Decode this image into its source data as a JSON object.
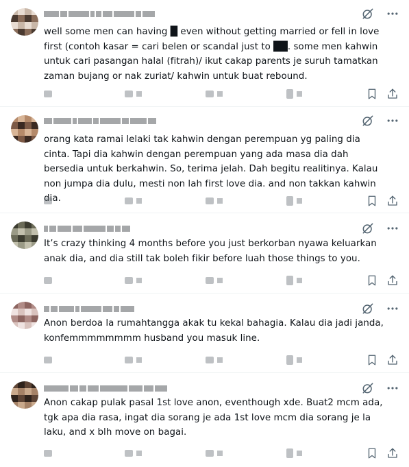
{
  "posts": [
    {
      "text": "well some men can having █ even without getting married or fell in love first (contoh kasar = cari belen or scandal just to ██. some men kahwin untuk cari pasangan halal (fitrah)/ ikut cakap parents je suruh tamatkan zaman bujang or nak zuriat/ kahwin untuk buat rebound.",
      "avatar_colors": [
        "#c9b7a8",
        "#8a6d5a",
        "#e8dcd2",
        "#4a3a30"
      ]
    },
    {
      "text": "orang kata ramai lelaki tak kahwin dengan perempuan yg paling dia cinta. Tapi dia kahwin dengan perempuan yang ada masa dia dah bersedia untuk berkahwin. So, terima jelah. Dah begitu realitinya. Kalau non jumpa dia dulu, mesti non lah first love dia. and non takkan kahwin dia.",
      "avatar_colors": [
        "#7d5a46",
        "#b58a6a",
        "#3b2a22",
        "#d8b597"
      ]
    },
    {
      "text": "It’s crazy thinking 4 months before you just berkorban nyawa keluarkan anak dia, and dia still tak boleh fikir before luah those things to you.",
      "avatar_colors": [
        "#6b6b58",
        "#9a9a86",
        "#3c3c30",
        "#c2c0ad"
      ]
    },
    {
      "text": "Anon berdoa la rumahtangga akak tu kekal bahagia. Kalau dia jadi janda, konfemmmmmmmm husband you masuk line.",
      "avatar_colors": [
        "#d9c3be",
        "#b08b86",
        "#efe3e1",
        "#8d6560"
      ]
    },
    {
      "text": "Anon cakap pulak pasal 1st love anon, eventhough xde. Buat2 mcm ada, tgk apa dia rasa, ingat dia sorang je ada 1st love mcm dia sorang je la laku, and x blh move on bagai.",
      "avatar_colors": [
        "#5e4536",
        "#a58267",
        "#2f231c",
        "#c9a98c"
      ]
    }
  ],
  "icons": {
    "grok": "grok-icon",
    "more": "more-icon",
    "reply": "reply-icon",
    "repost": "repost-icon",
    "like": "like-icon",
    "views": "views-icon",
    "bookmark": "bookmark-icon",
    "share": "share-icon"
  },
  "colors": {
    "text": "#0f1419",
    "icon": "#536471",
    "divider": "#eff3f4"
  }
}
